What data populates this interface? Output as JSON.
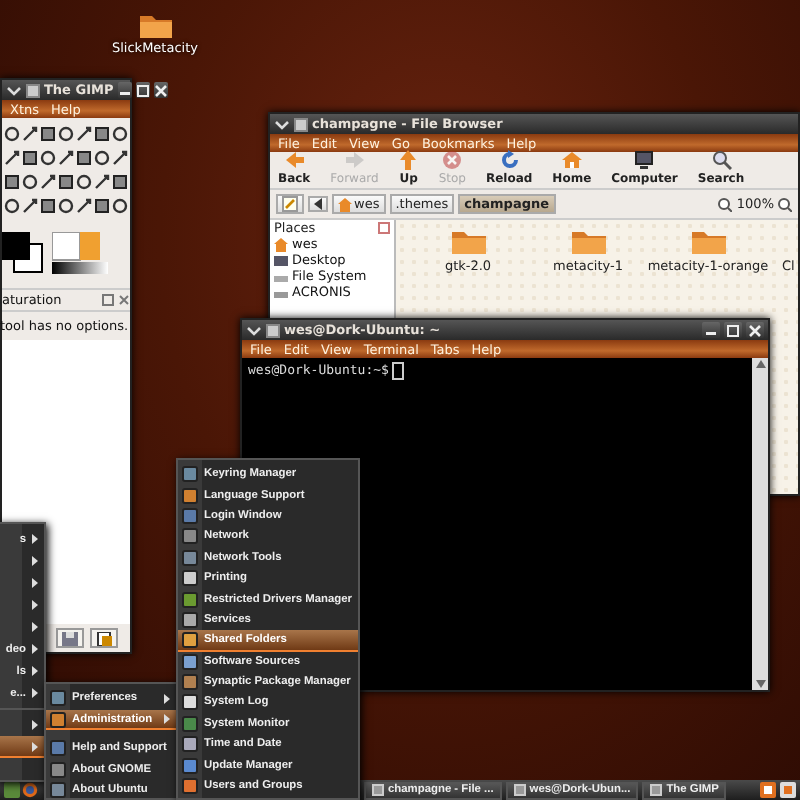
{
  "desktop_icons": [
    {
      "label": "SlickMetacity"
    }
  ],
  "gimp": {
    "title": "The GIMP",
    "menu": [
      "Xtns",
      "Help"
    ],
    "options_title": "aturation",
    "options_text": "tool has no options."
  },
  "file_browser": {
    "title": "champagne - File Browser",
    "menu": [
      "File",
      "Edit",
      "View",
      "Go",
      "Bookmarks",
      "Help"
    ],
    "toolbar": [
      {
        "label": "Back",
        "disabled": false
      },
      {
        "label": "Forward",
        "disabled": true
      },
      {
        "label": "Up",
        "disabled": false
      },
      {
        "label": "Stop",
        "disabled": true
      },
      {
        "label": "Reload",
        "disabled": false
      },
      {
        "label": "Home",
        "disabled": false
      },
      {
        "label": "Computer",
        "disabled": false
      },
      {
        "label": "Search",
        "disabled": false
      }
    ],
    "path": [
      {
        "label": "wes",
        "selected": false
      },
      {
        "label": ".themes",
        "selected": false
      },
      {
        "label": "champagne",
        "selected": true
      }
    ],
    "zoom": "100%",
    "places_header": "Places",
    "places": [
      "wes",
      "Desktop",
      "File System",
      "ACRONIS"
    ],
    "folders": [
      "gtk-2.0",
      "metacity-1",
      "metacity-1-orange",
      "Cl"
    ]
  },
  "terminal": {
    "title": "wes@Dork-Ubuntu: ~",
    "menu": [
      "File",
      "Edit",
      "View",
      "Terminal",
      "Tabs",
      "Help"
    ],
    "prompt": "wes@Dork-Ubuntu:~$"
  },
  "applications_menu": {
    "items": [
      {
        "label": "s",
        "selected": false
      },
      {
        "selected": false
      },
      {
        "selected": false
      },
      {
        "selected": false
      },
      {
        "selected": false
      },
      {
        "label": "deo",
        "selected": false
      },
      {
        "label": "ls",
        "selected": false
      },
      {
        "label": "e...",
        "selected": false
      },
      {
        "selected": false
      },
      {
        "selected": true
      }
    ]
  },
  "system_menu": {
    "items": [
      {
        "label": "Preferences",
        "submenu": true,
        "selected": false
      },
      {
        "label": "Administration",
        "submenu": true,
        "selected": true
      },
      {
        "label": "Help and Support",
        "submenu": false,
        "selected": false
      },
      {
        "label": "About GNOME",
        "submenu": false,
        "selected": false
      },
      {
        "label": "About Ubuntu",
        "submenu": false,
        "selected": false
      }
    ]
  },
  "administration_menu": {
    "items": [
      {
        "label": "Keyring Manager",
        "selected": false
      },
      {
        "label": "Language Support",
        "selected": false
      },
      {
        "label": "Login Window",
        "selected": false
      },
      {
        "label": "Network",
        "selected": false
      },
      {
        "label": "Network Tools",
        "selected": false
      },
      {
        "label": "Printing",
        "selected": false
      },
      {
        "label": "Restricted Drivers Manager",
        "selected": false
      },
      {
        "label": "Services",
        "selected": false
      },
      {
        "label": "Shared Folders",
        "selected": true
      },
      {
        "label": "Software Sources",
        "selected": false
      },
      {
        "label": "Synaptic Package Manager",
        "selected": false
      },
      {
        "label": "System Log",
        "selected": false
      },
      {
        "label": "System Monitor",
        "selected": false
      },
      {
        "label": "Time and Date",
        "selected": false
      },
      {
        "label": "Update Manager",
        "selected": false
      },
      {
        "label": "Users and Groups",
        "selected": false
      }
    ]
  },
  "taskbar": {
    "tasks": [
      {
        "label": "champagne - File ...",
        "selected": false
      },
      {
        "label": "wes@Dork-Ubun...",
        "selected": false
      },
      {
        "label": "The GIMP",
        "selected": false
      }
    ]
  }
}
